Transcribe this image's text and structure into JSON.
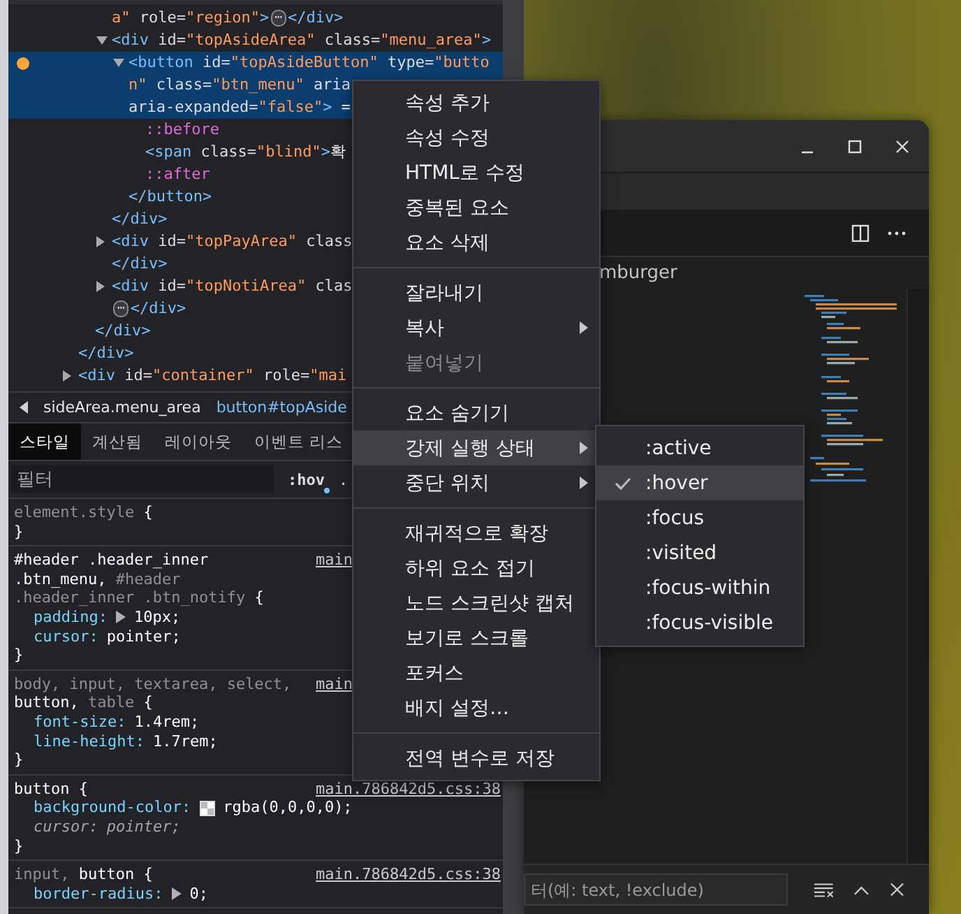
{
  "dom_tree": {
    "nodes": [
      {
        "children": [
          {
            "children": [
              {
                "selected": false,
                "lines": [
                  [
                    {
                      "kind": "val",
                      "text": "a\""
                    },
                    {
                      "kind": "attr",
                      "text": " role="
                    },
                    {
                      "kind": "val",
                      "text": "\"region\""
                    },
                    {
                      "kind": "tag",
                      "text": ">"
                    },
                    {
                      "kind": "more",
                      "text": "⋯"
                    },
                    {
                      "kind": "tag",
                      "text": "</div>"
                    }
                  ]
                ]
              },
              {
                "selected": false,
                "expanded": true,
                "lines": [
                  [
                    {
                      "kind": "tag",
                      "text": "<div"
                    },
                    {
                      "kind": "attr",
                      "text": " id="
                    },
                    {
                      "kind": "val",
                      "text": "\"topAsideArea\""
                    },
                    {
                      "kind": "attr",
                      "text": " class="
                    },
                    {
                      "kind": "val",
                      "text": "\"menu_area\""
                    },
                    {
                      "kind": "tag",
                      "text": ">"
                    }
                  ]
                ],
                "children": [
                  {
                    "selected": true,
                    "marker": true,
                    "expanded": true,
                    "lines": [
                      [
                        {
                          "kind": "tag",
                          "text": "<button"
                        },
                        {
                          "kind": "attr",
                          "text": " id="
                        },
                        {
                          "kind": "val",
                          "text": "\"topAsideButton\""
                        },
                        {
                          "kind": "attr",
                          "text": " type="
                        },
                        {
                          "kind": "val",
                          "text": "\"butto"
                        }
                      ],
                      [
                        {
                          "kind": "val",
                          "text": "n\""
                        },
                        {
                          "kind": "attr",
                          "text": " class="
                        },
                        {
                          "kind": "val",
                          "text": "\"btn_menu\""
                        },
                        {
                          "kind": "attr",
                          "text": " aria"
                        }
                      ],
                      [
                        {
                          "kind": "attr",
                          "text": "aria-expanded="
                        },
                        {
                          "kind": "val",
                          "text": "\"false\""
                        },
                        {
                          "kind": "tag",
                          "text": ">"
                        },
                        {
                          "kind": "text",
                          "text": " ="
                        }
                      ]
                    ],
                    "children": [
                      {
                        "selected": false,
                        "lines": [
                          [
                            {
                              "kind": "pseudo",
                              "text": "::before"
                            }
                          ]
                        ]
                      },
                      {
                        "selected": false,
                        "lines": [
                          [
                            {
                              "kind": "tag",
                              "text": "<span"
                            },
                            {
                              "kind": "attr",
                              "text": " class="
                            },
                            {
                              "kind": "val",
                              "text": "\"blind\""
                            },
                            {
                              "kind": "tag",
                              "text": ">"
                            },
                            {
                              "kind": "text",
                              "text": "확"
                            }
                          ]
                        ]
                      },
                      {
                        "selected": false,
                        "lines": [
                          [
                            {
                              "kind": "pseudo",
                              "text": "::after"
                            }
                          ]
                        ]
                      }
                    ],
                    "close": [
                      {
                        "kind": "tag",
                        "text": "</button>"
                      }
                    ]
                  }
                ],
                "close": [
                  {
                    "kind": "tag",
                    "text": "</div>"
                  }
                ]
              },
              {
                "selected": false,
                "expanded": false,
                "lines": [
                  [
                    {
                      "kind": "tag",
                      "text": "<div"
                    },
                    {
                      "kind": "attr",
                      "text": " id="
                    },
                    {
                      "kind": "val",
                      "text": "\"topPayArea\""
                    },
                    {
                      "kind": "attr",
                      "text": " class"
                    }
                  ]
                ],
                "close": [
                  {
                    "kind": "tag",
                    "text": "</div>"
                  }
                ]
              },
              {
                "selected": false,
                "expanded": false,
                "lines": [
                  [
                    {
                      "kind": "tag",
                      "text": "<div"
                    },
                    {
                      "kind": "attr",
                      "text": " id="
                    },
                    {
                      "kind": "val",
                      "text": "\"topNotiArea\""
                    },
                    {
                      "kind": "attr",
                      "text": " clas"
                    }
                  ]
                ],
                "close": [
                  {
                    "kind": "more",
                    "text": "⋯"
                  },
                  {
                    "kind": "tag",
                    "text": "</div>"
                  }
                ]
              }
            ],
            "close": [
              {
                "kind": "tag",
                "text": "</div>"
              }
            ]
          }
        ],
        "close": [
          {
            "kind": "tag",
            "text": "</div>"
          }
        ]
      },
      {
        "selected": false,
        "expanded": false,
        "lines": [
          [
            {
              "kind": "tag",
              "text": "<div"
            },
            {
              "kind": "attr",
              "text": " id="
            },
            {
              "kind": "val",
              "text": "\"container\""
            },
            {
              "kind": "attr",
              "text": " role="
            },
            {
              "kind": "val",
              "text": "\"mai"
            }
          ]
        ]
      }
    ]
  },
  "styles_pane": {
    "breadcrumbs": [
      {
        "label": "sideArea.menu_area",
        "selected": false
      },
      {
        "label": "button#topAside",
        "selected": true
      }
    ],
    "tabs": [
      {
        "label": "스타일",
        "selected": true
      },
      {
        "label": "계산됨",
        "selected": false
      },
      {
        "label": "레이아웃",
        "selected": false
      },
      {
        "label": "이벤트 리스",
        "selected": false
      }
    ],
    "filter": {
      "placeholder": "필터"
    },
    "hov_button": {
      "label": ":hov",
      "active": true
    },
    "cls_button": {
      "label": "."
    },
    "rules": [
      {
        "selector": [
          [
            {
              "t": "element.style",
              "matched": false
            },
            {
              "t": " {",
              "matched": true
            }
          ]
        ],
        "close": "}"
      },
      {
        "selector": [
          [
            {
              "t": "#header .header_inner",
              "matched": true
            }
          ],
          [
            {
              "t": ".btn_menu,",
              "matched": true
            },
            {
              "t": " #header",
              "matched": false
            }
          ],
          [
            {
              "t": ".header_inner .btn_notify",
              "matched": false
            },
            {
              "t": " {",
              "matched": true
            }
          ]
        ],
        "source": "main",
        "props": [
          {
            "name": "padding:",
            "value": "10px;",
            "expandable": true,
            "overridden": false
          },
          {
            "name": "cursor:",
            "value": "pointer;",
            "overridden": false
          }
        ],
        "close": "}"
      },
      {
        "selector": [
          [
            {
              "t": "body, input, textarea, select,",
              "matched": false
            }
          ],
          [
            {
              "t": "button,",
              "matched": true
            },
            {
              "t": " table",
              "matched": false
            },
            {
              "t": " {",
              "matched": true
            }
          ]
        ],
        "source": "main",
        "props": [
          {
            "name": "font-size:",
            "value": "1.4rem;",
            "overridden": false
          },
          {
            "name": "line-height:",
            "value": "1.7rem;",
            "overridden": false
          }
        ],
        "close": "}"
      },
      {
        "selector": [
          [
            {
              "t": "button",
              "matched": true
            },
            {
              "t": " {",
              "matched": true
            }
          ]
        ],
        "source": "main.786842d5.css:38",
        "props": [
          {
            "name": "background-color:",
            "value": "rgba(0,0,0,0);",
            "overridden": false,
            "swatch": true
          },
          {
            "name": "cursor:",
            "value": "pointer;",
            "overridden": true
          }
        ],
        "close": "}"
      },
      {
        "selector": [
          [
            {
              "t": "input,",
              "matched": false
            },
            {
              "t": " button",
              "matched": true
            },
            {
              "t": " {",
              "matched": true
            }
          ]
        ],
        "source": "main.786842d5.css:38",
        "props": [
          {
            "name": "border-radius:",
            "value": "0;",
            "expandable": true,
            "overridden": false
          }
        ]
      }
    ]
  },
  "editor_window": {
    "breadcrumb": "mburger",
    "find_bar": {
      "placeholder": "터(예: text, !exclude)"
    }
  },
  "context_menu": {
    "items": [
      {
        "kind": "item",
        "label": "속성 추가",
        "selected": false,
        "disabled": false,
        "submenu": false
      },
      {
        "kind": "item",
        "label": "속성 수정",
        "selected": false,
        "disabled": false,
        "submenu": false
      },
      {
        "kind": "item",
        "label": "HTML로 수정",
        "selected": false,
        "disabled": false,
        "submenu": false
      },
      {
        "kind": "item",
        "label": "중복된 요소",
        "selected": false,
        "disabled": false,
        "submenu": false
      },
      {
        "kind": "item",
        "label": "요소 삭제",
        "selected": false,
        "disabled": false,
        "submenu": false
      },
      {
        "kind": "separator"
      },
      {
        "kind": "item",
        "label": "잘라내기",
        "selected": false,
        "disabled": false,
        "submenu": false
      },
      {
        "kind": "item",
        "label": "복사",
        "selected": false,
        "disabled": false,
        "submenu": true
      },
      {
        "kind": "item",
        "label": "붙여넣기",
        "selected": false,
        "disabled": true,
        "submenu": false
      },
      {
        "kind": "separator"
      },
      {
        "kind": "item",
        "label": "요소 숨기기",
        "selected": false,
        "disabled": false,
        "submenu": false
      },
      {
        "kind": "item",
        "label": "강제 실행 상태",
        "selected": true,
        "disabled": false,
        "submenu": true
      },
      {
        "kind": "item",
        "label": "중단 위치",
        "selected": false,
        "disabled": false,
        "submenu": true
      },
      {
        "kind": "separator"
      },
      {
        "kind": "item",
        "label": "재귀적으로 확장",
        "selected": false,
        "disabled": false,
        "submenu": false
      },
      {
        "kind": "item",
        "label": "하위 요소 접기",
        "selected": false,
        "disabled": false,
        "submenu": false
      },
      {
        "kind": "item",
        "label": "노드 스크린샷 캡처",
        "selected": false,
        "disabled": false,
        "submenu": false
      },
      {
        "kind": "item",
        "label": "보기로 스크롤",
        "selected": false,
        "disabled": false,
        "submenu": false
      },
      {
        "kind": "item",
        "label": "포커스",
        "selected": false,
        "disabled": false,
        "submenu": false
      },
      {
        "kind": "item",
        "label": "배지 설정…",
        "selected": false,
        "disabled": false,
        "submenu": false
      },
      {
        "kind": "separator"
      },
      {
        "kind": "item",
        "label": "전역 변수로 저장",
        "selected": false,
        "disabled": false,
        "submenu": false
      }
    ]
  },
  "submenu": {
    "items": [
      {
        "label": ":active",
        "checked": false,
        "selected": false
      },
      {
        "label": ":hover",
        "checked": true,
        "selected": true
      },
      {
        "label": ":focus",
        "checked": false,
        "selected": false
      },
      {
        "label": ":visited",
        "checked": false,
        "selected": false
      },
      {
        "label": ":focus-within",
        "checked": false,
        "selected": false
      },
      {
        "label": ":focus-visible",
        "checked": false,
        "selected": false
      }
    ]
  }
}
